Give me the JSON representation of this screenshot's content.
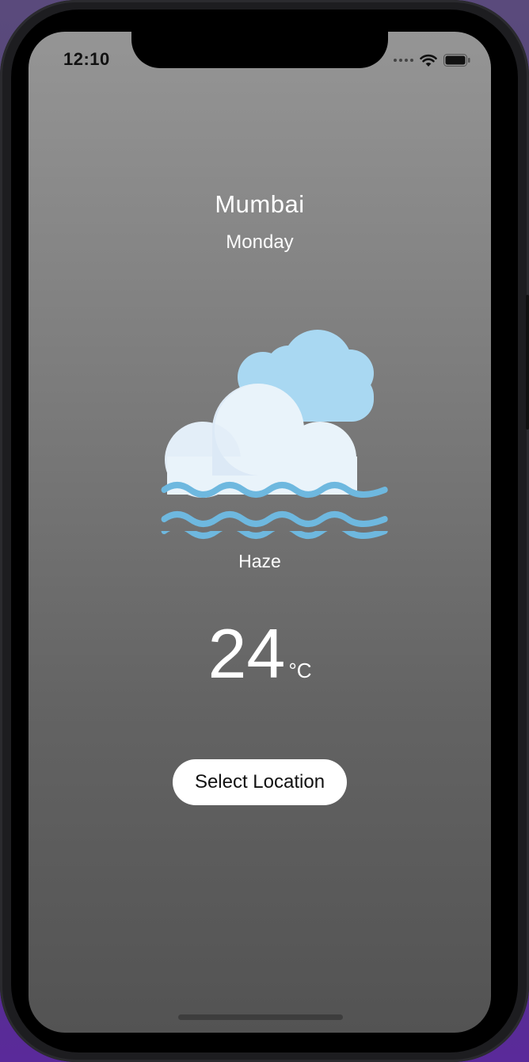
{
  "status_bar": {
    "time": "12:10",
    "icons": [
      "signal-dots-icon",
      "wifi-icon",
      "battery-icon"
    ]
  },
  "weather": {
    "city": "Mumbai",
    "day": "Monday",
    "condition": "Haze",
    "icon": "haze-cloud-icon",
    "temperature": "24",
    "unit": "°C"
  },
  "actions": {
    "select_location_label": "Select Location"
  },
  "colors": {
    "cloud_front": "#E3EEF8",
    "cloud_back": "#A9D8F2",
    "haze_waves": "#6EB8DF",
    "button_bg": "#FFFFFF"
  }
}
